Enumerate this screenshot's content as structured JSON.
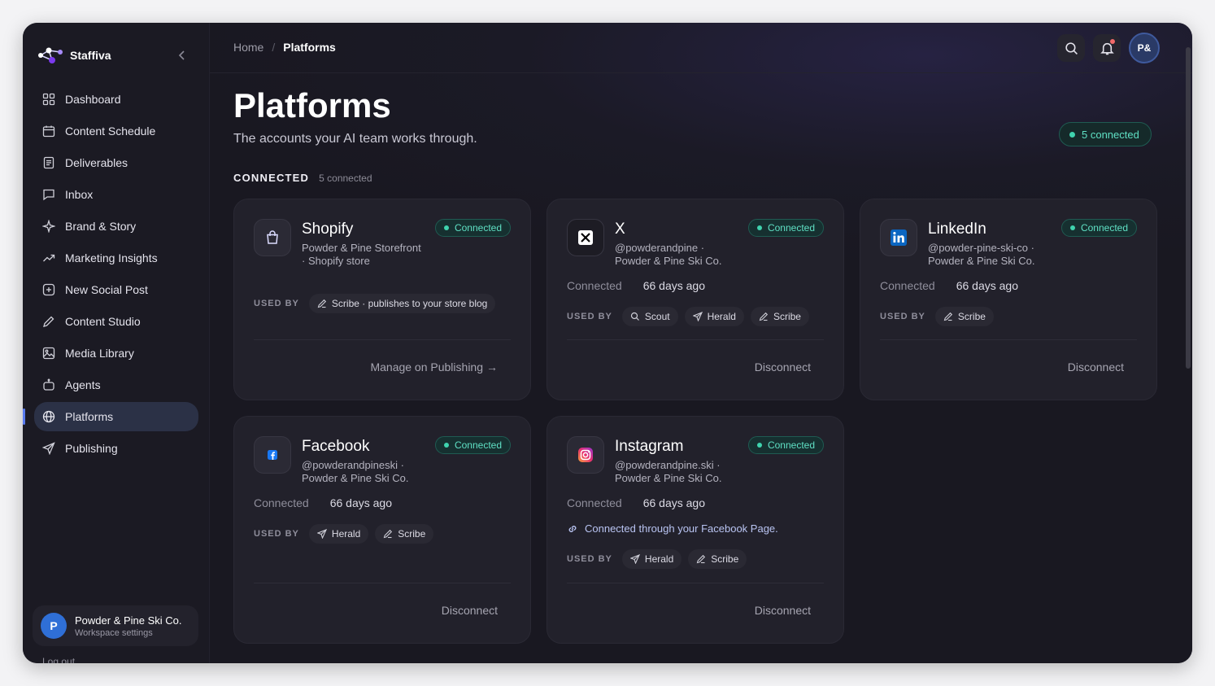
{
  "brand": {
    "name": "Staffiva"
  },
  "nav": [
    {
      "label": "Dashboard",
      "icon": "grid-icon"
    },
    {
      "label": "Content Schedule",
      "icon": "calendar-icon"
    },
    {
      "label": "Deliverables",
      "icon": "document-icon"
    },
    {
      "label": "Inbox",
      "icon": "message-icon"
    },
    {
      "label": "Brand & Story",
      "icon": "sparkle-icon"
    },
    {
      "label": "Marketing Insights",
      "icon": "trend-icon"
    },
    {
      "label": "New Social Post",
      "icon": "plus-square-icon"
    },
    {
      "label": "Content Studio",
      "icon": "pencil-icon"
    },
    {
      "label": "Media Library",
      "icon": "image-icon"
    },
    {
      "label": "Agents",
      "icon": "bot-icon"
    },
    {
      "label": "Platforms",
      "icon": "globe-icon",
      "active": true
    },
    {
      "label": "Publishing",
      "icon": "send-icon"
    }
  ],
  "workspace": {
    "avatar": "P",
    "name": "Powder & Pine Ski Co.",
    "sub": "Workspace settings"
  },
  "logout": "Log out",
  "breadcrumb": {
    "home": "Home",
    "sep": "/",
    "current": "Platforms"
  },
  "user": {
    "initials": "P&"
  },
  "page": {
    "title": "Platforms",
    "subtitle": "The accounts your AI team works through.",
    "count_pill": "5 connected",
    "section_title": "CONNECTED",
    "section_count": "5 connected"
  },
  "labels": {
    "used_by": "USED BY",
    "connected": "Connected"
  },
  "cards": {
    "shopify": {
      "title": "Shopify",
      "sub": "Powder & Pine Storefront · Shopify store",
      "badge": "Connected",
      "chips": [
        "Scribe · publishes to your store blog"
      ],
      "action": "Manage on Publishing",
      "action_arrow": "→"
    },
    "x": {
      "title": "X",
      "sub": "@powderandpine · Powder & Pine Ski Co.",
      "badge": "Connected",
      "meta_value": "66 days ago",
      "chips": [
        "Scout",
        "Herald",
        "Scribe"
      ],
      "action": "Disconnect"
    },
    "linkedin": {
      "title": "LinkedIn",
      "sub": "@powder-pine-ski-co · Powder & Pine Ski Co.",
      "badge": "Connected",
      "meta_value": "66 days ago",
      "chips": [
        "Scribe"
      ],
      "action": "Disconnect"
    },
    "facebook": {
      "title": "Facebook",
      "sub": "@powderandpineski · Powder & Pine Ski Co.",
      "badge": "Connected",
      "meta_value": "66 days ago",
      "chips": [
        "Herald",
        "Scribe"
      ],
      "action": "Disconnect"
    },
    "instagram": {
      "title": "Instagram",
      "sub": "@powderandpine.ski · Powder & Pine Ski Co.",
      "badge": "Connected",
      "meta_value": "66 days ago",
      "via": "Connected through your Facebook Page.",
      "chips": [
        "Herald",
        "Scribe"
      ],
      "action": "Disconnect"
    }
  },
  "colors": {
    "accent": "#5fe0c4",
    "active_nav": "#2b3146",
    "background": "#17151f"
  }
}
